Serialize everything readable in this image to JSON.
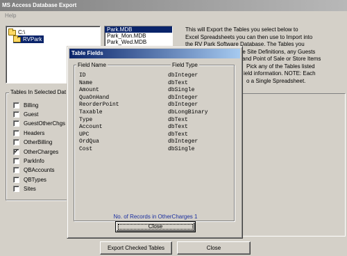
{
  "window": {
    "title": "MS Access Database Export"
  },
  "menu": {
    "help": "Help"
  },
  "directories": [
    {
      "label": "C:\\",
      "selected": false,
      "indent": 0
    },
    {
      "label": "RVPark",
      "selected": true,
      "indent": 1
    }
  ],
  "files": [
    {
      "label": "Park.MDB",
      "selected": true
    },
    {
      "label": "Park_Mon.MDB",
      "selected": false
    },
    {
      "label": "Park_Wed.MDB",
      "selected": false
    }
  ],
  "description": "This will Export the Tables you select below to Excel Spreadsheets you can then use to Import into the RV Park Software Database. The Tables you ... n the Site Definitions, any Guests ... and Point of Sale or Store Items ... Pick any of the Tables listed ... ield information. NOTE: Each ... o a Single Spreadsheet.",
  "description_lines": [
    "This will Export the Tables you select below to",
    "Excel Spreadsheets you can then use to Import into",
    "the RV Park Software Database.  The Tables you",
    "n the Site Definitions, any Guests",
    "and Point of Sale or Store Items",
    "Pick any of the Tables listed",
    "ield information.  NOTE: Each",
    "o a Single Spreadsheet."
  ],
  "tables_group": {
    "title": "Tables In Selected Dat",
    "items": [
      {
        "label": "Billing",
        "checked": false
      },
      {
        "label": "Guest",
        "checked": false
      },
      {
        "label": "GuestOtherChgs",
        "checked": false
      },
      {
        "label": "Headers",
        "checked": false
      },
      {
        "label": "OtherBilling",
        "checked": false
      },
      {
        "label": "OtherCharges",
        "checked": true
      },
      {
        "label": "ParkInfo",
        "checked": false
      },
      {
        "label": "QBAccounts",
        "checked": false
      },
      {
        "label": "QBTypes",
        "checked": false
      },
      {
        "label": "Sites",
        "checked": false
      }
    ]
  },
  "buttons": {
    "export": "Export Checked Tables",
    "close": "Close"
  },
  "modal": {
    "title": "Table Fields",
    "col_name": "Field Name",
    "col_type": "Field Type",
    "fields": [
      {
        "name": "ID",
        "type": "dbInteger"
      },
      {
        "name": "Name",
        "type": "dbText"
      },
      {
        "name": "Amount",
        "type": "dbSingle"
      },
      {
        "name": "QuaOnHand",
        "type": "dbInteger"
      },
      {
        "name": "ReorderPoint",
        "type": "dbInteger"
      },
      {
        "name": "Taxable",
        "type": "dbLongBinary"
      },
      {
        "name": "Type",
        "type": "dbText"
      },
      {
        "name": "Account",
        "type": "dbText"
      },
      {
        "name": "UPC",
        "type": "dbText"
      },
      {
        "name": "OrdQua",
        "type": "dbInteger"
      },
      {
        "name": "Cost",
        "type": "dbSingle"
      }
    ],
    "records_text": "No. of Records in OtherCharges  1",
    "close": "Close"
  },
  "colors": {
    "title_active": "#0a246a",
    "title_inactive": "#808080",
    "selection": "#0a246a",
    "records_text": "#1a2fa0",
    "face": "#d4d0c8"
  }
}
